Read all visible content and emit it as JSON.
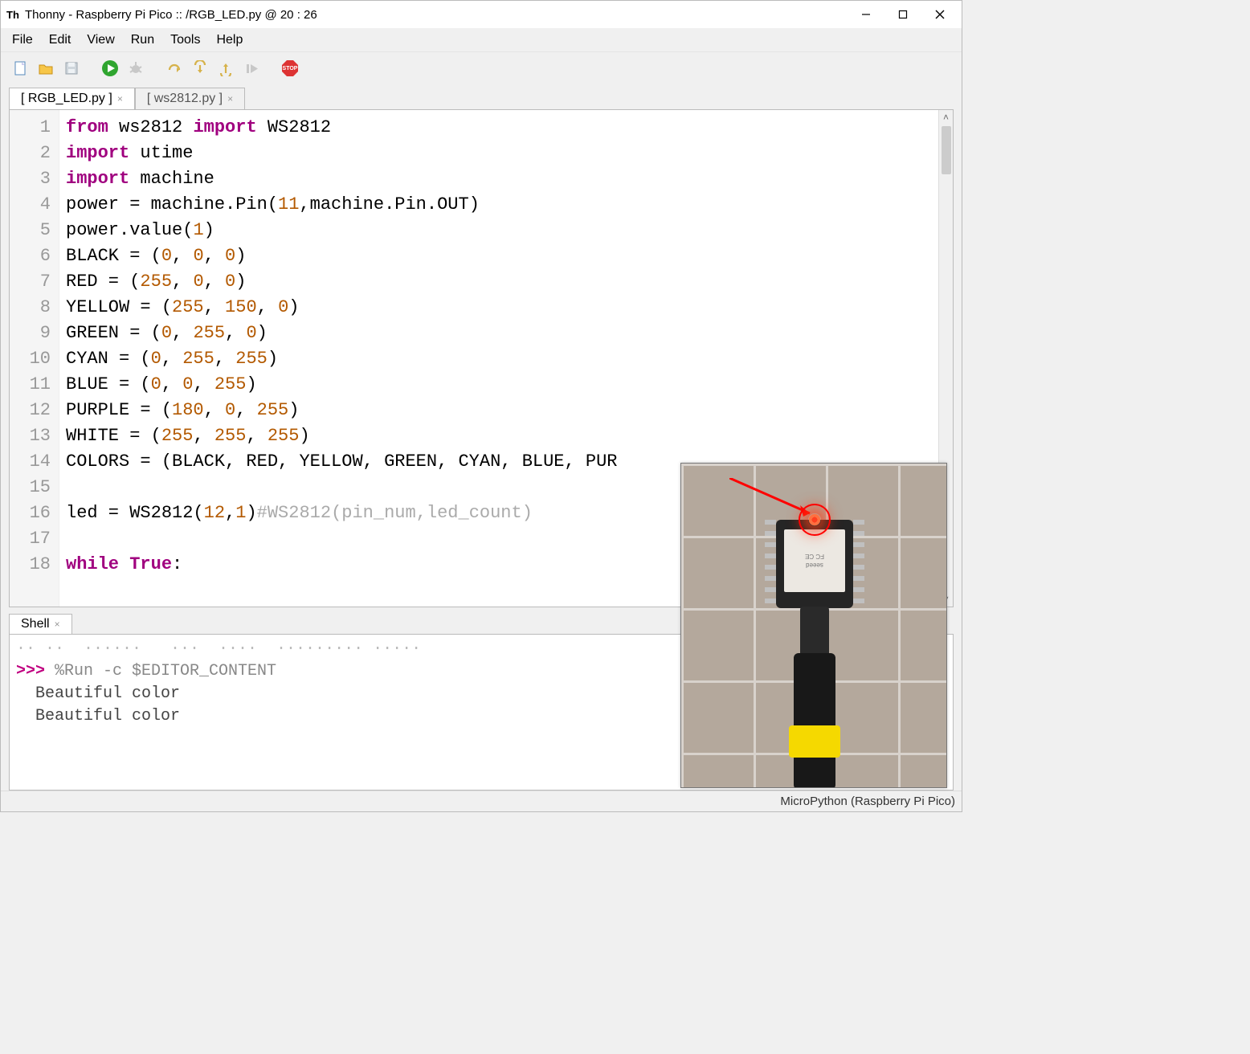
{
  "titlebar": {
    "app_icon_text": "Th",
    "title": "Thonny  -  Raspberry Pi Pico :: /RGB_LED.py  @  20 : 26"
  },
  "menubar": {
    "items": [
      "File",
      "Edit",
      "View",
      "Run",
      "Tools",
      "Help"
    ]
  },
  "toolbar": {
    "icons": [
      "new-file-icon",
      "open-file-icon",
      "save-file-icon",
      "run-icon",
      "debug-icon",
      "step-over-icon",
      "step-into-icon",
      "step-out-icon",
      "resume-icon",
      "stop-icon"
    ]
  },
  "tabs": {
    "files": [
      {
        "label": "[ RGB_LED.py ]",
        "active": true
      },
      {
        "label": "[ ws2812.py ]",
        "active": false
      }
    ]
  },
  "editor": {
    "line_count": 18,
    "lines": [
      [
        {
          "t": "from ",
          "c": "kw"
        },
        {
          "t": "ws2812 "
        },
        {
          "t": "import ",
          "c": "kw"
        },
        {
          "t": "WS2812"
        }
      ],
      [
        {
          "t": "import ",
          "c": "kw"
        },
        {
          "t": "utime"
        }
      ],
      [
        {
          "t": "import ",
          "c": "kw"
        },
        {
          "t": "machine"
        }
      ],
      [
        {
          "t": "power = machine.Pin("
        },
        {
          "t": "11",
          "c": "num"
        },
        {
          "t": ",machine.Pin.OUT)"
        }
      ],
      [
        {
          "t": "power.value("
        },
        {
          "t": "1",
          "c": "num"
        },
        {
          "t": ")"
        }
      ],
      [
        {
          "t": "BLACK = ("
        },
        {
          "t": "0",
          "c": "num"
        },
        {
          "t": ", "
        },
        {
          "t": "0",
          "c": "num"
        },
        {
          "t": ", "
        },
        {
          "t": "0",
          "c": "num"
        },
        {
          "t": ")"
        }
      ],
      [
        {
          "t": "RED = ("
        },
        {
          "t": "255",
          "c": "num"
        },
        {
          "t": ", "
        },
        {
          "t": "0",
          "c": "num"
        },
        {
          "t": ", "
        },
        {
          "t": "0",
          "c": "num"
        },
        {
          "t": ")"
        }
      ],
      [
        {
          "t": "YELLOW = ("
        },
        {
          "t": "255",
          "c": "num"
        },
        {
          "t": ", "
        },
        {
          "t": "150",
          "c": "num"
        },
        {
          "t": ", "
        },
        {
          "t": "0",
          "c": "num"
        },
        {
          "t": ")"
        }
      ],
      [
        {
          "t": "GREEN = ("
        },
        {
          "t": "0",
          "c": "num"
        },
        {
          "t": ", "
        },
        {
          "t": "255",
          "c": "num"
        },
        {
          "t": ", "
        },
        {
          "t": "0",
          "c": "num"
        },
        {
          "t": ")"
        }
      ],
      [
        {
          "t": "CYAN = ("
        },
        {
          "t": "0",
          "c": "num"
        },
        {
          "t": ", "
        },
        {
          "t": "255",
          "c": "num"
        },
        {
          "t": ", "
        },
        {
          "t": "255",
          "c": "num"
        },
        {
          "t": ")"
        }
      ],
      [
        {
          "t": "BLUE = ("
        },
        {
          "t": "0",
          "c": "num"
        },
        {
          "t": ", "
        },
        {
          "t": "0",
          "c": "num"
        },
        {
          "t": ", "
        },
        {
          "t": "255",
          "c": "num"
        },
        {
          "t": ")"
        }
      ],
      [
        {
          "t": "PURPLE = ("
        },
        {
          "t": "180",
          "c": "num"
        },
        {
          "t": ", "
        },
        {
          "t": "0",
          "c": "num"
        },
        {
          "t": ", "
        },
        {
          "t": "255",
          "c": "num"
        },
        {
          "t": ")"
        }
      ],
      [
        {
          "t": "WHITE = ("
        },
        {
          "t": "255",
          "c": "num"
        },
        {
          "t": ", "
        },
        {
          "t": "255",
          "c": "num"
        },
        {
          "t": ", "
        },
        {
          "t": "255",
          "c": "num"
        },
        {
          "t": ")"
        }
      ],
      [
        {
          "t": "COLORS = (BLACK, RED, YELLOW, GREEN, CYAN, BLUE, PUR"
        }
      ],
      [
        {
          "t": ""
        }
      ],
      [
        {
          "t": "led = WS2812("
        },
        {
          "t": "12",
          "c": "num"
        },
        {
          "t": ","
        },
        {
          "t": "1",
          "c": "num"
        },
        {
          "t": ")"
        },
        {
          "t": "#WS2812(pin_num,led_count)",
          "c": "cmt"
        }
      ],
      [
        {
          "t": ""
        }
      ],
      [
        {
          "t": "while ",
          "c": "kw"
        },
        {
          "t": "True",
          "c": "kw"
        },
        {
          "t": ":"
        }
      ]
    ]
  },
  "shell": {
    "tab_label": "Shell",
    "prompt": ">>> ",
    "run_cmd": "%Run -c $EDITOR_CONTENT",
    "output": [
      "  Beautiful color",
      "  Beautiful color"
    ]
  },
  "statusbar": {
    "backend": "MicroPython (Raspberry Pi Pico)"
  },
  "photo": {
    "chip_label_top": "seeed",
    "chip_label_bottom": "FC CE"
  }
}
